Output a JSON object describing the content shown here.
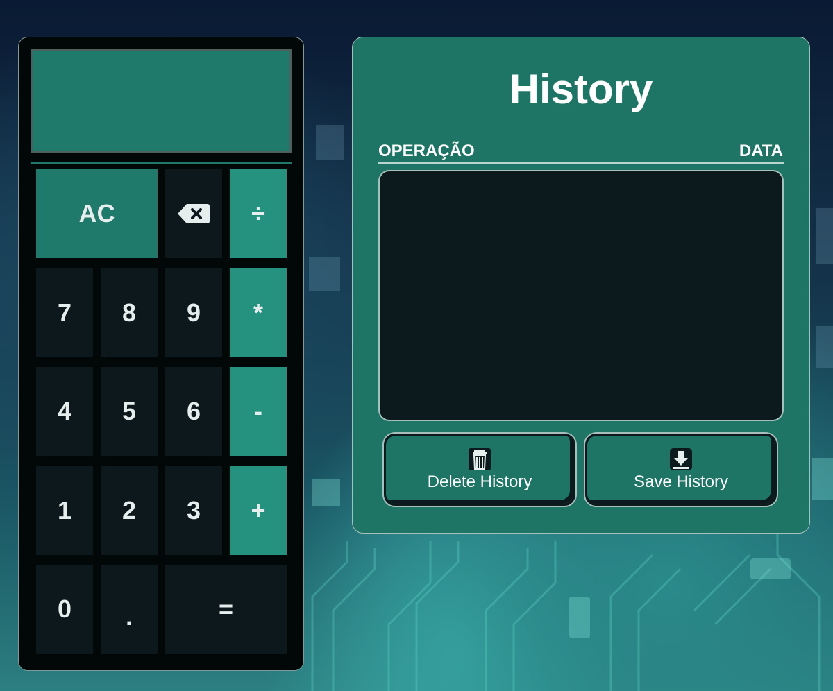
{
  "calculator": {
    "display_value": "",
    "keys": {
      "ac": "AC",
      "divide": "÷",
      "multiply": "*",
      "subtract": "-",
      "add": "+",
      "equals": "=",
      "decimal": ".",
      "d0": "0",
      "d1": "1",
      "d2": "2",
      "d3": "3",
      "d4": "4",
      "d5": "5",
      "d6": "6",
      "d7": "7",
      "d8": "8",
      "d9": "9"
    },
    "backspace_icon": "backspace-icon"
  },
  "history": {
    "title": "History",
    "columns": {
      "operation": "OPERAÇÃO",
      "date": "DATA"
    },
    "entries": [],
    "delete_label": "Delete History",
    "save_label": "Save History",
    "delete_icon": "trash-icon",
    "save_icon": "download-icon"
  },
  "colors": {
    "accent": "#1e7566",
    "operator": "#25917f",
    "key_bg": "#0c181b",
    "panel_dark": "#0c1a1d"
  }
}
